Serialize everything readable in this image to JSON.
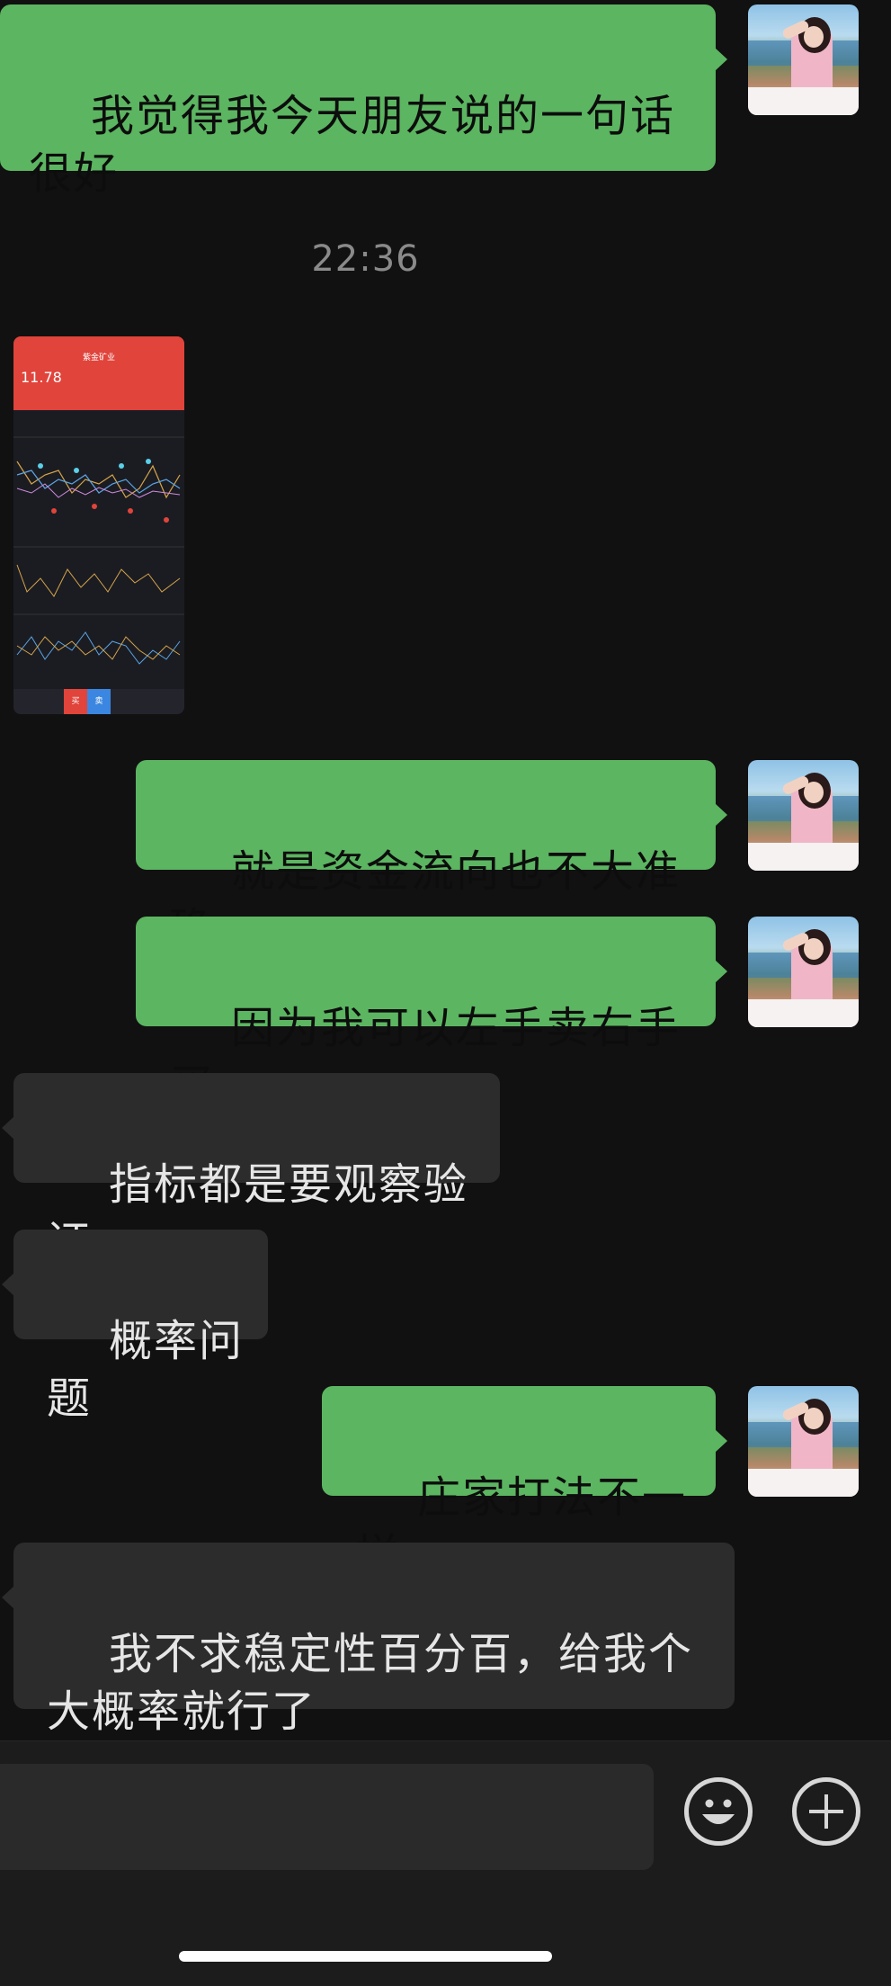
{
  "messages": [
    {
      "sender": "me",
      "text": "我觉得我今天朋友说的一句话很好"
    },
    {
      "type": "timestamp",
      "text": "22:36"
    },
    {
      "sender": "other",
      "type": "image",
      "image": {
        "stock_name": "紫金矿业",
        "price": "11.78",
        "buy_label": "买",
        "sell_label": "卖"
      }
    },
    {
      "sender": "me",
      "text": "就是资金流向也不大准确"
    },
    {
      "sender": "me",
      "text": "因为我可以左手卖右手买"
    },
    {
      "sender": "other",
      "text": "指标都是要观察验证"
    },
    {
      "sender": "other",
      "text": "概率问题"
    },
    {
      "sender": "me",
      "text": "庄家打法不一样"
    },
    {
      "sender": "other",
      "text": "我不求稳定性百分百，给我个大概率就行了"
    }
  ],
  "input_bar": {
    "emoji_icon": "emoji-icon",
    "plus_icon": "plus-icon"
  },
  "colors": {
    "background": "#111111",
    "my_bubble": "#5cb561",
    "other_bubble": "#2c2c2c"
  }
}
